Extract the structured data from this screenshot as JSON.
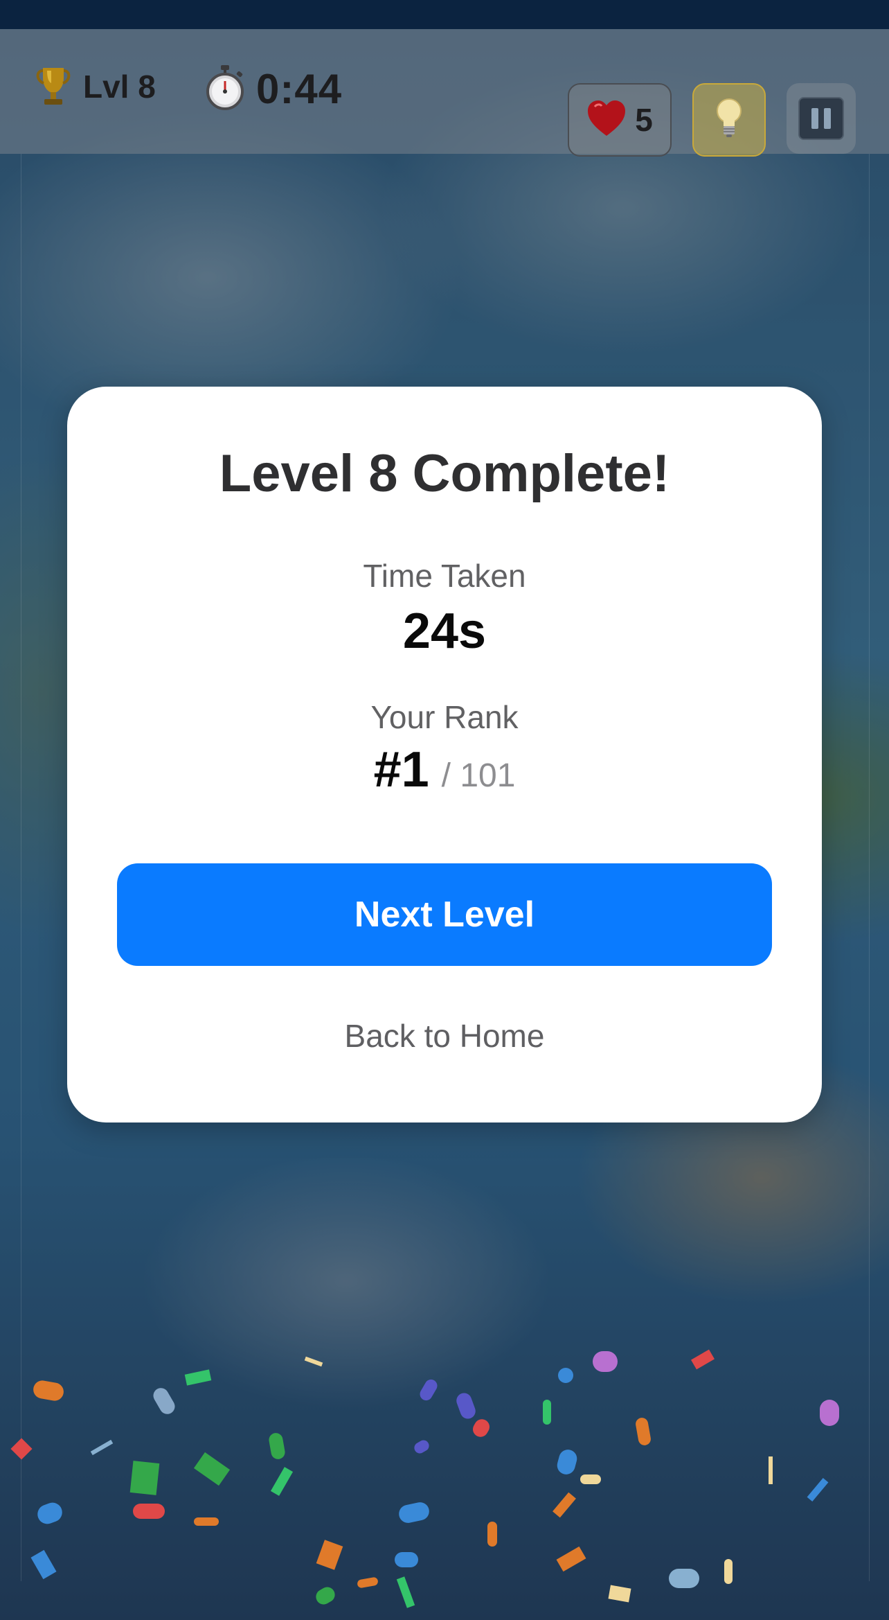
{
  "hud": {
    "level_label": "Lvl 8",
    "timer": "0:44",
    "lives": "5",
    "icons": [
      "trophy-icon",
      "stopwatch-icon",
      "heart-icon",
      "lightbulb-icon",
      "pause-icon"
    ]
  },
  "modal": {
    "title": "Level 8 Complete!",
    "time_label": "Time Taken",
    "time_value": "24s",
    "rank_label": "Your Rank",
    "rank_value": "#1",
    "rank_total": "/ 101",
    "next_button": "Next Level",
    "home_link": "Back to Home"
  },
  "colors": {
    "accent": "#0a7bff",
    "modal_bg": "#ffffff",
    "hint_bg": "#c9a93a",
    "heart": "#b3121a"
  }
}
